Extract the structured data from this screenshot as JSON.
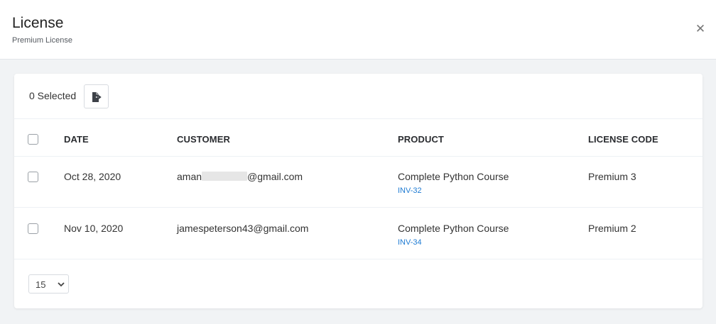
{
  "header": {
    "title": "License",
    "subtitle": "Premium License",
    "close_icon": "close-icon"
  },
  "toolbar": {
    "selected_label": "0 Selected",
    "export_icon": "export-icon"
  },
  "table": {
    "columns": [
      "DATE",
      "CUSTOMER",
      "PRODUCT",
      "LICENSE CODE"
    ],
    "rows": [
      {
        "date": "Oct 28, 2020",
        "customer_prefix": "aman",
        "customer_suffix": "@gmail.com",
        "customer_redacted": true,
        "product": "Complete Python Course",
        "invoice": "INV-32",
        "license_code": "Premium 3"
      },
      {
        "date": "Nov 10, 2020",
        "customer": "jamespeterson43@gmail.com",
        "product": "Complete Python Course",
        "invoice": "INV-34",
        "license_code": "Premium 2"
      }
    ]
  },
  "pagination": {
    "page_size": "15"
  },
  "colors": {
    "link": "#1e7bd3",
    "background": "#f1f3f5"
  }
}
